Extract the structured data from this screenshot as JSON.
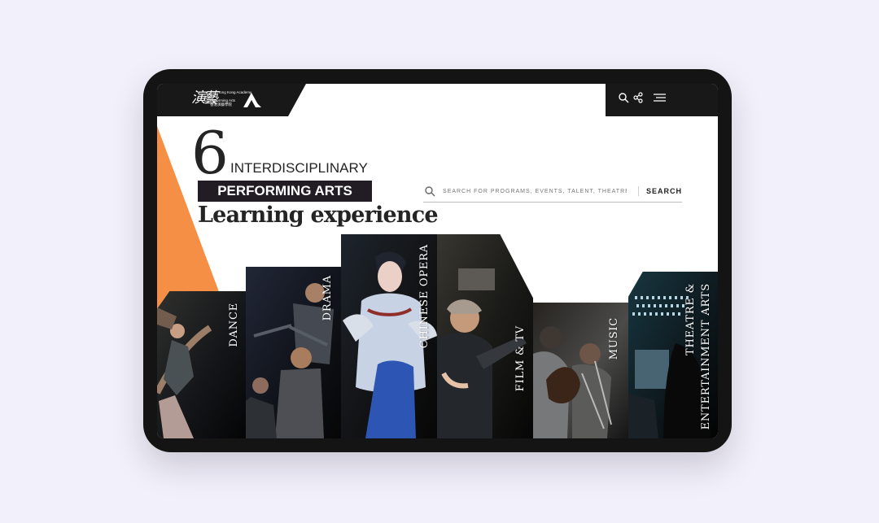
{
  "brand": {
    "script": "演藝",
    "line1": "The Hong Kong Academy",
    "line2": "for",
    "line3": "Performing Arts",
    "line4": "香港演藝學院"
  },
  "hero": {
    "number": "6",
    "line1": "INTERDISCIPLINARY",
    "highlight": "PERFORMING ARTS",
    "title": "Learning experience"
  },
  "search": {
    "placeholder": "SEARCH FOR PROGRAMS, EVENTS, TALENT, THEATRE...",
    "button": "SEARCH"
  },
  "disciplines": [
    {
      "label": "DANCE"
    },
    {
      "label": "DRAMA"
    },
    {
      "label": "CHINESE OPERA"
    },
    {
      "label": "FILM & TV"
    },
    {
      "label": "MUSIC"
    },
    {
      "label": "THEATRE &"
    },
    {
      "label": "ENTERTAINMENT ARTS"
    }
  ],
  "icons": {
    "header": [
      "search-icon",
      "share-icon",
      "menu-icon"
    ],
    "search": "search-icon"
  },
  "colors": {
    "page_bg": "#f2f0fa",
    "device": "#141414",
    "header": "#181818",
    "accent": "#f58f45",
    "dark_label": "#221d24",
    "text_dark": "#242424"
  }
}
